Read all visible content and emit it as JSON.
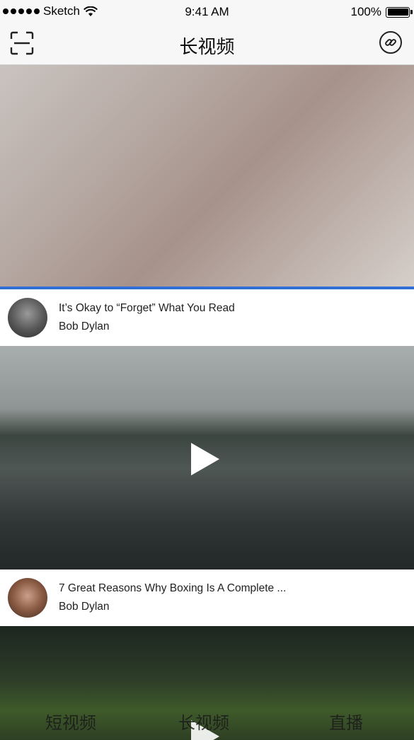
{
  "status_bar": {
    "carrier": "Sketch",
    "time": "9:41 AM",
    "battery": "100%"
  },
  "nav": {
    "title": "长视频"
  },
  "feed": [
    {
      "title": "It’s Okay to “Forget” What You Read",
      "author": "Bob Dylan",
      "progress": 1.0
    },
    {
      "title": "7 Great Reasons Why Boxing Is A Complete ...",
      "author": "Bob Dylan"
    }
  ],
  "tabbar": {
    "items": [
      "短视频",
      "长视频",
      "直播"
    ]
  },
  "icons": {
    "scan": "scan-icon",
    "link": "link-icon",
    "play": "play-icon"
  },
  "colors": {
    "progress": "#2f6fd6"
  }
}
